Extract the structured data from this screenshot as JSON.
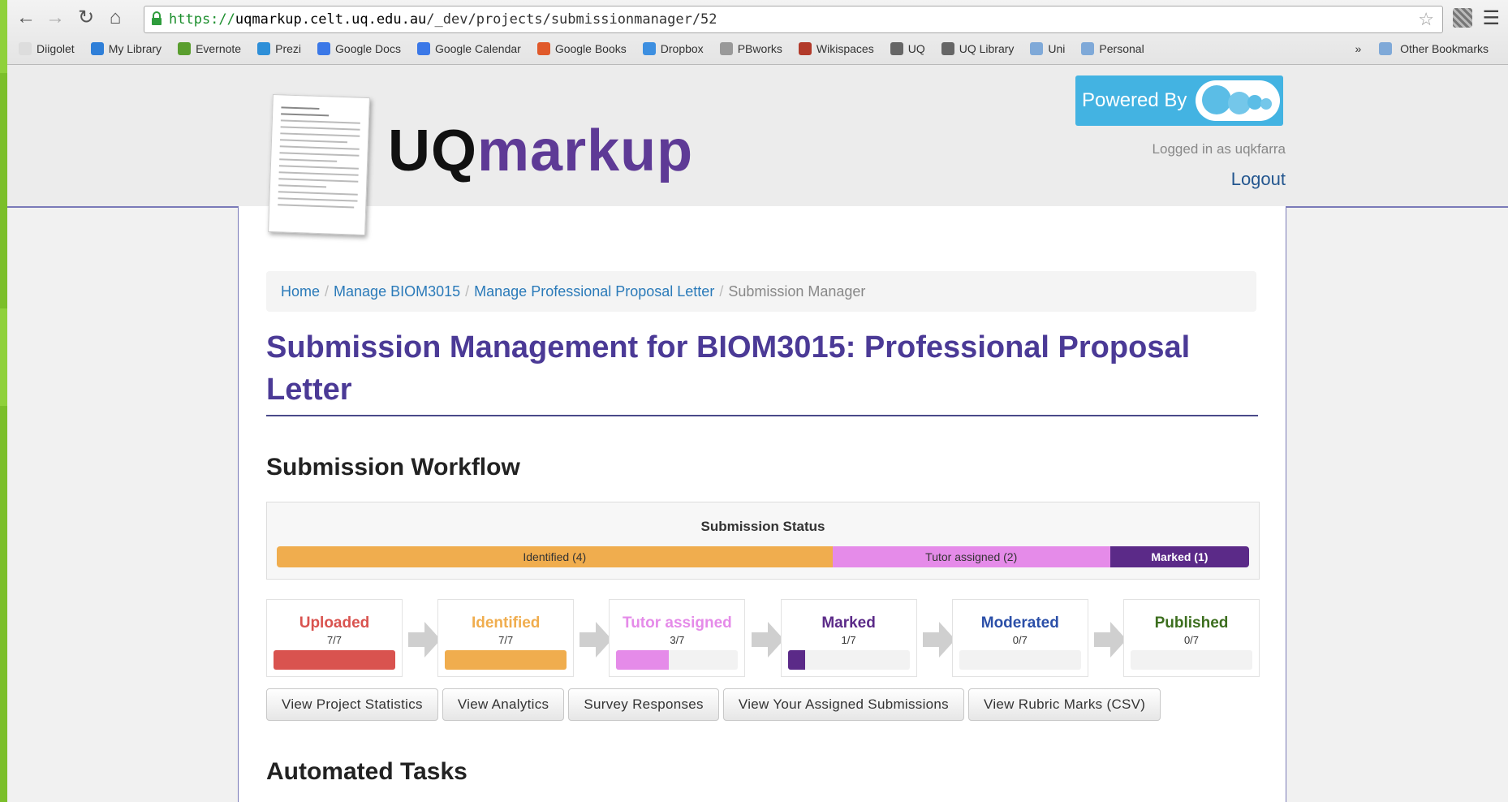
{
  "browser": {
    "url_scheme": "https://",
    "url_host": "uqmarkup.celt.uq.edu.au",
    "url_path": "/_dev/projects/submissionmanager/52",
    "bookmarks": [
      {
        "label": "Diigolet",
        "icon": "page-icon",
        "color": "#dddddd"
      },
      {
        "label": "My Library",
        "icon": "library-icon",
        "color": "#2f7fd8"
      },
      {
        "label": "Evernote",
        "icon": "evernote-icon",
        "color": "#5a9e2f"
      },
      {
        "label": "Prezi",
        "icon": "prezi-icon",
        "color": "#2e8fd8"
      },
      {
        "label": "Google Docs",
        "icon": "docs-icon",
        "color": "#3b78e7"
      },
      {
        "label": "Google Calendar",
        "icon": "calendar-icon",
        "color": "#3b78e7"
      },
      {
        "label": "Google Books",
        "icon": "books-icon",
        "color": "#e0592a"
      },
      {
        "label": "Dropbox",
        "icon": "dropbox-icon",
        "color": "#3d8fe0"
      },
      {
        "label": "PBworks",
        "icon": "pbworks-icon",
        "color": "#999999"
      },
      {
        "label": "Wikispaces",
        "icon": "wikispaces-icon",
        "color": "#b23a2a"
      },
      {
        "label": "UQ",
        "icon": "uq-icon",
        "color": "#666666"
      },
      {
        "label": "UQ Library",
        "icon": "uq-library-icon",
        "color": "#666666"
      },
      {
        "label": "Uni",
        "icon": "folder-icon",
        "color": "#7fa9d8"
      },
      {
        "label": "Personal",
        "icon": "folder-icon",
        "color": "#7fa9d8"
      }
    ],
    "overflow_chevron": "»",
    "other_bookmarks": "Other Bookmarks"
  },
  "header": {
    "logo_uq": "UQ",
    "logo_markup": "markup",
    "powered_by": "Powered By",
    "logged_in_as": "Logged in as uqkfarra",
    "logout": "Logout"
  },
  "breadcrumb": {
    "items": [
      "Home",
      "Manage BIOM3015",
      "Manage Professional Proposal Letter"
    ],
    "separator": "/",
    "current": "Submission Manager"
  },
  "page_title": "Submission Management for BIOM3015: Professional Proposal Letter",
  "workflow": {
    "heading": "Submission Workflow",
    "status_title": "Submission Status",
    "status_segments": [
      {
        "label": "Identified (4)",
        "count": 4,
        "color": "#f0ad4e",
        "text_color": "#333333"
      },
      {
        "label": "Tutor assigned (2)",
        "count": 2,
        "color": "#e58be9",
        "text_color": "#333333"
      },
      {
        "label": "Marked (1)",
        "count": 1,
        "color": "#5b2a88",
        "text_color": "#ffffff"
      }
    ],
    "stages": [
      {
        "name": "Uploaded",
        "count": "7/7",
        "fraction": 1.0,
        "color": "#d9534f"
      },
      {
        "name": "Identified",
        "count": "7/7",
        "fraction": 1.0,
        "color": "#f0ad4e"
      },
      {
        "name": "Tutor assigned",
        "count": "3/7",
        "fraction": 0.4286,
        "color": "#e58be9"
      },
      {
        "name": "Marked",
        "count": "1/7",
        "fraction": 0.1429,
        "color": "#5b2a88"
      },
      {
        "name": "Moderated",
        "count": "0/7",
        "fraction": 0.0,
        "color": "#2b4fa8"
      },
      {
        "name": "Published",
        "count": "0/7",
        "fraction": 0.0,
        "color": "#3c6e1e"
      }
    ],
    "buttons": [
      "View Project Statistics",
      "View Analytics",
      "Survey Responses",
      "View Your Assigned Submissions",
      "View Rubric Marks (CSV)"
    ]
  },
  "automated": {
    "heading": "Automated Tasks"
  }
}
